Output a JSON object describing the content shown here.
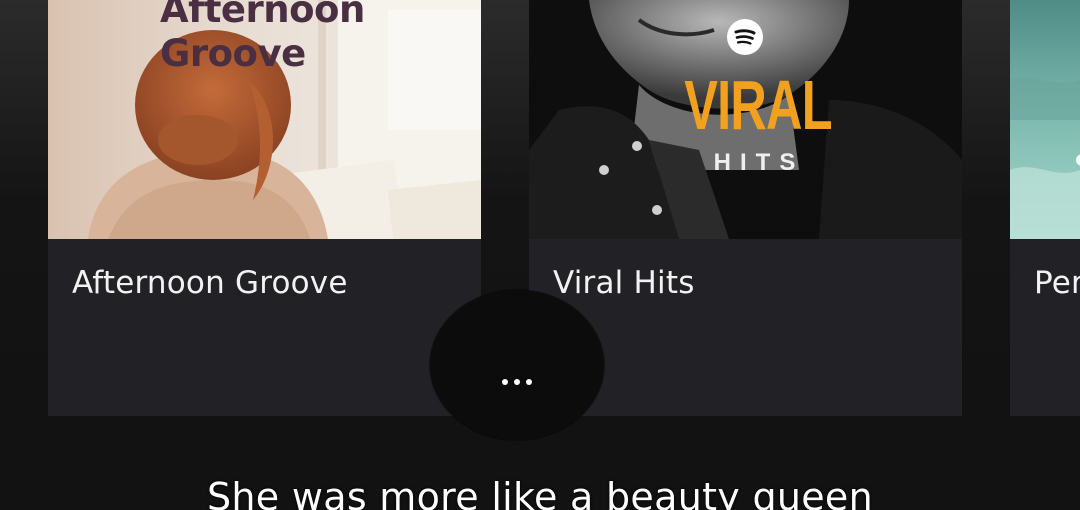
{
  "playlists": [
    {
      "title": "Afternoon Groove",
      "cover_text_line1": "Afternoon",
      "cover_text_line2": "Groove"
    },
    {
      "title": "Viral Hits",
      "cover_text_main": "VIRAL",
      "cover_text_sub": "HITS",
      "cover_icon": "spotify-icon"
    },
    {
      "title": "Per"
    }
  ],
  "more_button": {
    "icon": "more-dots-icon"
  },
  "lyric_line": "She was more like a beauty queen",
  "colors": {
    "background": "#121212",
    "card": "#222226",
    "viral_accent": "#f2a11f",
    "groove_text": "#4a2f42"
  }
}
